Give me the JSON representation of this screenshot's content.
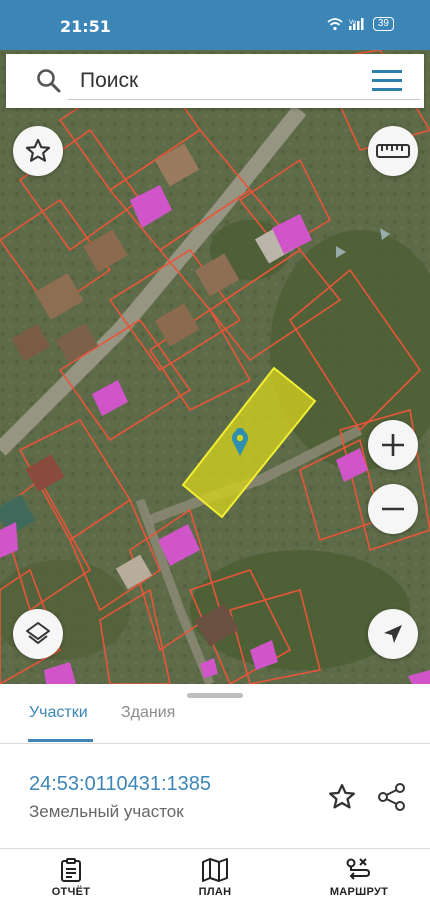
{
  "status_bar": {
    "time": "21:51",
    "battery": "39"
  },
  "search": {
    "placeholder": "Поиск"
  },
  "map": {
    "accent_color": "#3b86b7",
    "parcel_outline_color": "#e8553a",
    "selected_parcel_color": "#d8d41c",
    "building_color": "#cf55c9"
  },
  "tabs": [
    {
      "label": "Участки",
      "active": true
    },
    {
      "label": "Здания",
      "active": false
    }
  ],
  "parcel": {
    "cadastral_number": "24:53:0110431:1385",
    "type": "Земельный участок"
  },
  "bottom_nav": [
    {
      "label": "ОТЧЁТ",
      "icon": "clipboard-icon"
    },
    {
      "label": "ПЛАН",
      "icon": "map-icon"
    },
    {
      "label": "МАРШРУТ",
      "icon": "route-icon"
    }
  ]
}
